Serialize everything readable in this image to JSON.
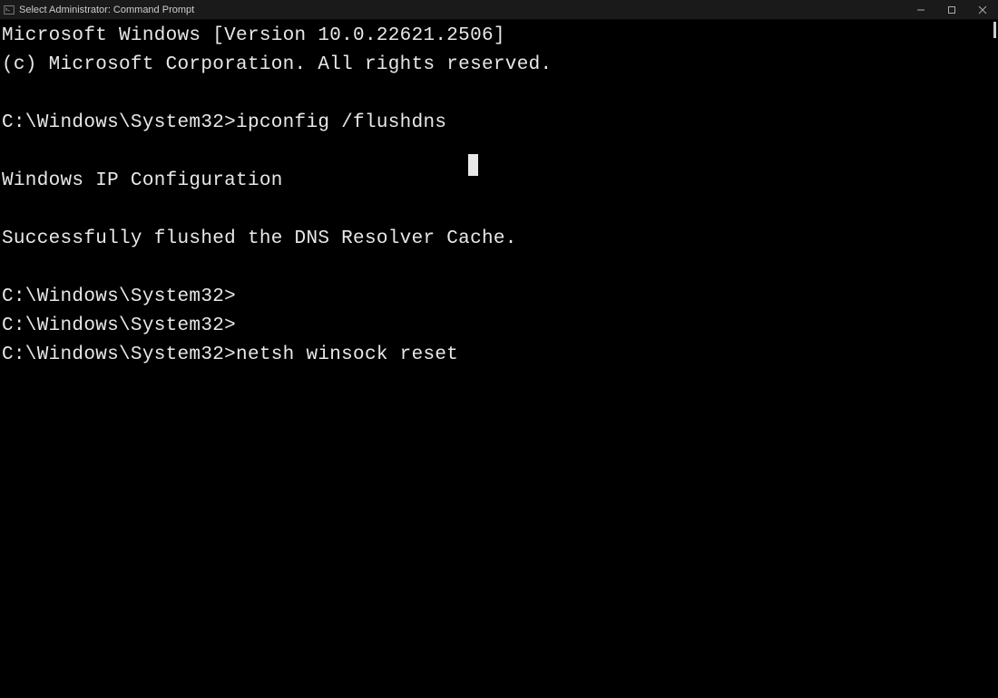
{
  "titlebar": {
    "title": "Select Administrator: Command Prompt"
  },
  "terminal": {
    "lines": [
      "Microsoft Windows [Version 10.0.22621.2506]",
      "(c) Microsoft Corporation. All rights reserved.",
      "",
      "C:\\Windows\\System32>ipconfig /flushdns",
      "",
      "Windows IP Configuration",
      "",
      "Successfully flushed the DNS Resolver Cache.",
      "",
      "C:\\Windows\\System32>",
      "C:\\Windows\\System32>",
      "C:\\Windows\\System32>netsh winsock reset"
    ]
  }
}
